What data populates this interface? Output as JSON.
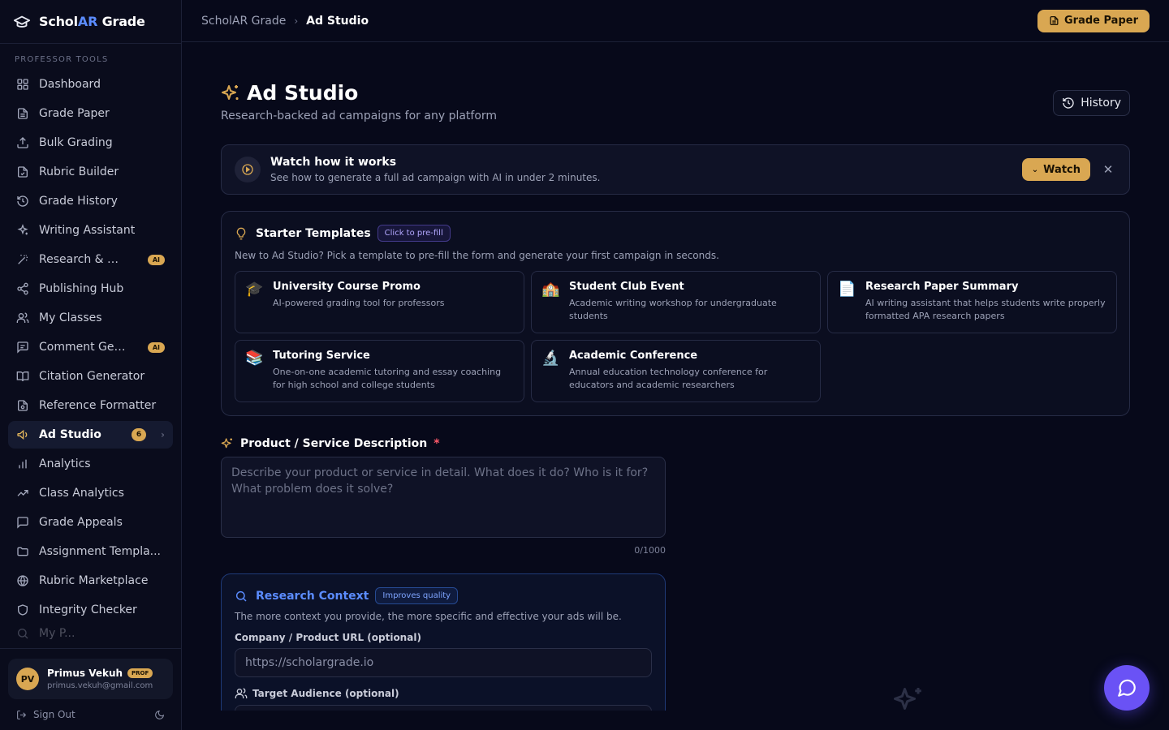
{
  "app": {
    "logo_pre": "Schol",
    "logo_ar": "AR",
    "logo_post": " Grade"
  },
  "sidebar": {
    "section_label": "PROFESSOR TOOLS",
    "items": [
      {
        "label": "Dashboard",
        "icon": "layout-grid-icon"
      },
      {
        "label": "Grade Paper",
        "icon": "file-text-icon"
      },
      {
        "label": "Bulk Grading",
        "icon": "upload-icon"
      },
      {
        "label": "Rubric Builder",
        "icon": "file-check-icon"
      },
      {
        "label": "Grade History",
        "icon": "history-icon"
      },
      {
        "label": "Writing Assistant",
        "icon": "sparkles-icon"
      },
      {
        "label": "Research & Wri...",
        "icon": "wand-icon",
        "badge": "AI"
      },
      {
        "label": "Publishing Hub",
        "icon": "share-icon"
      },
      {
        "label": "My Classes",
        "icon": "users-icon"
      },
      {
        "label": "Comment Gene...",
        "icon": "message-square-icon",
        "badge": "AI"
      },
      {
        "label": "Citation Generator",
        "icon": "book-open-icon"
      },
      {
        "label": "Reference Formatter",
        "icon": "file-cog-icon"
      },
      {
        "label": "Ad Studio",
        "icon": "megaphone-icon",
        "count": "6",
        "active": true
      },
      {
        "label": "Analytics",
        "icon": "bar-chart-icon"
      },
      {
        "label": "Class Analytics",
        "icon": "trending-up-icon"
      },
      {
        "label": "Grade Appeals",
        "icon": "message-square-icon"
      },
      {
        "label": "Assignment Templa...",
        "icon": "folder-icon"
      },
      {
        "label": "Rubric Marketplace",
        "icon": "globe-icon"
      },
      {
        "label": "Integrity Checker",
        "icon": "shield-icon"
      },
      {
        "label": "My P...",
        "icon": "search-icon"
      }
    ],
    "user": {
      "initials": "PV",
      "name": "Primus Vekuh",
      "role_badge": "PROF",
      "email": "primus.vekuh@gmail.com"
    },
    "sign_out": "Sign Out"
  },
  "topbar": {
    "breadcrumb_root": "ScholAR Grade",
    "breadcrumb_current": "Ad Studio",
    "grade_button": "Grade Paper"
  },
  "page": {
    "title": "Ad Studio",
    "subtitle": "Research-backed ad campaigns for any platform",
    "history_button": "History"
  },
  "watch": {
    "title": "Watch how it works",
    "description": "See how to generate a full ad campaign with AI in under 2 minutes.",
    "button": "Watch"
  },
  "templates": {
    "title": "Starter Templates",
    "pill": "Click to pre-fill",
    "description": "New to Ad Studio? Pick a template to pre-fill the form and generate your first campaign in seconds.",
    "items": [
      {
        "emoji": "🎓",
        "name": "University Course Promo",
        "text": "AI-powered grading tool for professors"
      },
      {
        "emoji": "🏫",
        "name": "Student Club Event",
        "text": "Academic writing workshop for undergraduate students"
      },
      {
        "emoji": "📄",
        "name": "Research Paper Summary",
        "text": "AI writing assistant that helps students write properly formatted APA research papers"
      },
      {
        "emoji": "📚",
        "name": "Tutoring Service",
        "text": "One-on-one academic tutoring and essay coaching for high school and college students"
      },
      {
        "emoji": "🔬",
        "name": "Academic Conference",
        "text": "Annual education technology conference for educators and academic researchers"
      }
    ]
  },
  "form": {
    "description_label": "Product / Service Description",
    "required_mark": "*",
    "description_placeholder": "Describe your product or service in detail. What does it do? Who is it for? What problem does it solve?",
    "char_count": "0/1000",
    "research": {
      "title": "Research Context",
      "pill": "Improves quality",
      "description": "The more context you provide, the more specific and effective your ads will be.",
      "url_label": "Company / Product URL (optional)",
      "url_placeholder": "https://scholargrade.io",
      "audience_label": "Target Audience (optional)"
    }
  },
  "colors": {
    "background": "#07091a",
    "accent_gold": "#d9a752",
    "accent_blue": "#5b8cff",
    "accent_purple": "#6a52f5",
    "required": "#ff5a6a"
  }
}
